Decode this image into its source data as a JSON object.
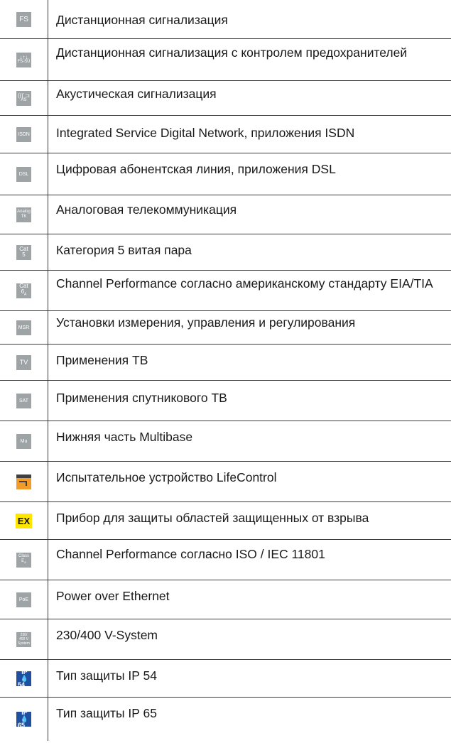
{
  "rows": [
    {
      "icon": "FS",
      "icon_name": "fs-icon",
      "text": "Дистанционная сигнализация"
    },
    {
      "icon": "FS-SÜ",
      "icon_name": "fs-su-icon",
      "text": "Дистанционная сигнализация с контролем предохранителей"
    },
    {
      "icon": "AS",
      "icon_name": "acoustic-signal-icon",
      "text": "Акустическая сигнализация"
    },
    {
      "icon": "ISDN",
      "icon_name": "isdn-icon",
      "text": "Integrated Service Digital Network, приложения ISDN"
    },
    {
      "icon": "DSL",
      "icon_name": "dsl-icon",
      "text": "Цифровая абонентская линия, приложения DSL"
    },
    {
      "icon": "Analog TK",
      "icon_name": "analog-tk-icon",
      "text": "Аналоговая телекоммуникация"
    },
    {
      "icon": "Cat 5",
      "icon_name": "cat5-icon",
      "text": "Категория 5 витая пара"
    },
    {
      "icon": "Cat 6A",
      "icon_name": "cat6a-icon",
      "text": "Channel Performance согласно американскому стандарту  EIA/TIA"
    },
    {
      "icon": "MSR",
      "icon_name": "msr-icon",
      "text": "Установки измерения, управления и регулирования"
    },
    {
      "icon": "TV",
      "icon_name": "tv-icon",
      "text": "Применения ТВ"
    },
    {
      "icon": "SAT",
      "icon_name": "sat-icon",
      "text": "Применения спутникового ТВ"
    },
    {
      "icon": "Mu",
      "icon_name": "multibase-icon",
      "text": "Нижняя часть Multibase"
    },
    {
      "icon": "LifeControl",
      "icon_name": "lifecontrol-icon",
      "text": "Испытательное устройство LifeControl"
    },
    {
      "icon": "EX",
      "icon_name": "ex-icon",
      "text": "Прибор для защиты областей защищенных от взрыва"
    },
    {
      "icon": "Class EA",
      "icon_name": "class-ea-icon",
      "text": "Channel Performance согласно ISO / IEC 11801"
    },
    {
      "icon": "PoE",
      "icon_name": "poe-icon",
      "text": "Power over Ethernet"
    },
    {
      "icon": "230/ 400 V System",
      "icon_name": "230-400v-system-icon",
      "text": "230/400 V-System"
    },
    {
      "icon": "IP 54",
      "icon_name": "ip54-icon",
      "text": "Тип защиты IP 54"
    },
    {
      "icon": "IP 65",
      "icon_name": "ip65-icon",
      "text": "Тип защиты IP 65"
    }
  ],
  "colors": {
    "icon_grey": "#9ea3a6",
    "ex_yellow": "#ffe600",
    "ip_blue": "#1f4fa0",
    "lifecontrol_orange": "#f29b2a"
  }
}
